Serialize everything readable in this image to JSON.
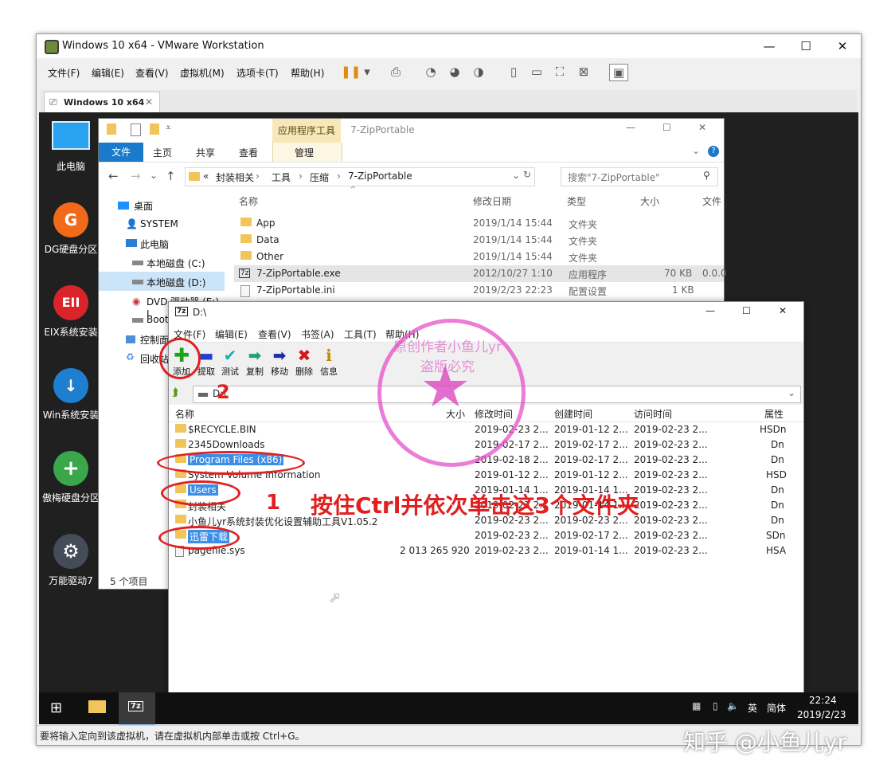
{
  "vmware": {
    "title": "Windows 10 x64 - VMware Workstation",
    "menu": [
      "文件(F)",
      "编辑(E)",
      "查看(V)",
      "虚拟机(M)",
      "选项卡(T)",
      "帮助(H)"
    ],
    "tab_label": "Windows 10 x64",
    "status": "要将输入定向到该虚拟机，请在虚拟机内部单击或按 Ctrl+G。"
  },
  "desktop": {
    "icons": [
      {
        "label": "此电脑",
        "color": "#1e90ff"
      },
      {
        "label": "DG硬盘分区",
        "color": "#f06a1a",
        "glyph": "G"
      },
      {
        "label": "EIX系统安装",
        "color": "#d9252a",
        "glyph": "EII"
      },
      {
        "label": "Win系统安装",
        "color": "#1e7fd1",
        "glyph": "↓"
      },
      {
        "label": "傲梅硬盘分区",
        "color": "#3aa84a",
        "glyph": "+"
      },
      {
        "label": "万能驱动7",
        "color": "#444c57",
        "glyph": "⚙"
      }
    ]
  },
  "taskbar": {
    "ime1": "英",
    "ime2": "简体",
    "time": "22:24",
    "date": "2019/2/23"
  },
  "explorer": {
    "ribbon_ctx": "应用程序工具",
    "title": "7-ZipPortable",
    "tabs": [
      "文件",
      "主页",
      "共享",
      "查看",
      "管理"
    ],
    "breadcrumb": [
      "«",
      "封装相关",
      "工具",
      "压缩",
      "7-ZipPortable"
    ],
    "search_placeholder": "搜索\"7-ZipPortable\"",
    "nav": [
      "桌面",
      "SYSTEM",
      "此电脑",
      "本地磁盘 (C:)",
      "本地磁盘 (D:)",
      "DVD 驱动器 (E:) I",
      "Boot",
      "控制面",
      "回收站"
    ],
    "columns": [
      "名称",
      "修改日期",
      "类型",
      "大小",
      "文件"
    ],
    "rows": [
      {
        "name": "App",
        "date": "2019/1/14 15:44",
        "type": "文件夹",
        "size": "",
        "extra": ""
      },
      {
        "name": "Data",
        "date": "2019/1/14 15:44",
        "type": "文件夹",
        "size": "",
        "extra": ""
      },
      {
        "name": "Other",
        "date": "2019/1/14 15:44",
        "type": "文件夹",
        "size": "",
        "extra": ""
      },
      {
        "name": "7-ZipPortable.exe",
        "date": "2012/10/27 1:10",
        "type": "应用程序",
        "size": "70 KB",
        "extra": "0.0.0"
      },
      {
        "name": "7-ZipPortable.ini",
        "date": "2019/2/23 22:23",
        "type": "配置设置",
        "size": "1 KB",
        "extra": ""
      }
    ],
    "item_count": "5 个项目"
  },
  "sevenzip": {
    "title": "D:\\",
    "menu": [
      "文件(F)",
      "编辑(E)",
      "查看(V)",
      "书签(A)",
      "工具(T)",
      "帮助(H)"
    ],
    "toolbar": [
      {
        "label": "添加",
        "glyph": "✚",
        "color": "#1aa31a"
      },
      {
        "label": "提取",
        "glyph": "▬",
        "color": "#2040d0"
      },
      {
        "label": "测试",
        "glyph": "✔",
        "color": "#20b0b0"
      },
      {
        "label": "复制",
        "glyph": "➡",
        "color": "#20a080"
      },
      {
        "label": "移动",
        "glyph": "➡",
        "color": "#1a2ea8"
      },
      {
        "label": "删除",
        "glyph": "✖",
        "color": "#d01a1a"
      },
      {
        "label": "信息",
        "glyph": "ℹ",
        "color": "#c08a00"
      }
    ],
    "path": "D:\\",
    "columns": [
      "名称",
      "大小",
      "修改时间",
      "创建时间",
      "访问时间",
      "属性"
    ],
    "rows": [
      {
        "name": "$RECYCLE.BIN",
        "size": "",
        "mod": "2019-02-23 2...",
        "created": "2019-01-12 2...",
        "access": "2019-02-23 2...",
        "attr": "HSDn",
        "selected": false
      },
      {
        "name": "2345Downloads",
        "size": "",
        "mod": "2019-02-17 2...",
        "created": "2019-02-17 2...",
        "access": "2019-02-23 2...",
        "attr": "Dn",
        "selected": false
      },
      {
        "name": "Program Files (x86)",
        "size": "",
        "mod": "2019-02-18 2...",
        "created": "2019-02-17 2...",
        "access": "2019-02-23 2...",
        "attr": "Dn",
        "selected": true
      },
      {
        "name": "System Volume Information",
        "size": "",
        "mod": "2019-01-12 2...",
        "created": "2019-01-12 2...",
        "access": "2019-02-23 2...",
        "attr": "HSD",
        "selected": false
      },
      {
        "name": "Users",
        "size": "",
        "mod": "2019-01-14 1...",
        "created": "2019-01-14 1...",
        "access": "2019-02-23 2...",
        "attr": "Dn",
        "selected": true
      },
      {
        "name": "封装相关",
        "size": "",
        "mod": "2019-02-23 2...",
        "created": "2019-01-14 1...",
        "access": "2019-02-23 2...",
        "attr": "Dn",
        "selected": false
      },
      {
        "name": "小鱼儿yr系统封装优化设置辅助工具V1.05.2",
        "size": "",
        "mod": "2019-02-23 2...",
        "created": "2019-02-23 2...",
        "access": "2019-02-23 2...",
        "attr": "Dn",
        "selected": false
      },
      {
        "name": "迅雷下载",
        "size": "",
        "mod": "2019-02-23 2...",
        "created": "2019-02-17 2...",
        "access": "2019-02-23 2...",
        "attr": "SDn",
        "selected": true
      },
      {
        "name": "pagefile.sys",
        "size": "2 013 265 920",
        "mod": "2019-02-23 2...",
        "created": "2019-01-14 1...",
        "access": "2019-02-23 2...",
        "attr": "HSA",
        "selected": false
      }
    ]
  },
  "annotations": {
    "step1": "1",
    "step2": "2",
    "instruction": "按住Ctrl并依次单击这3个文件夹",
    "stamp_text": "原创作者小鱼儿yr 盗版必究",
    "accent": "#e02020"
  },
  "watermark": "知乎 @小鱼儿yr"
}
